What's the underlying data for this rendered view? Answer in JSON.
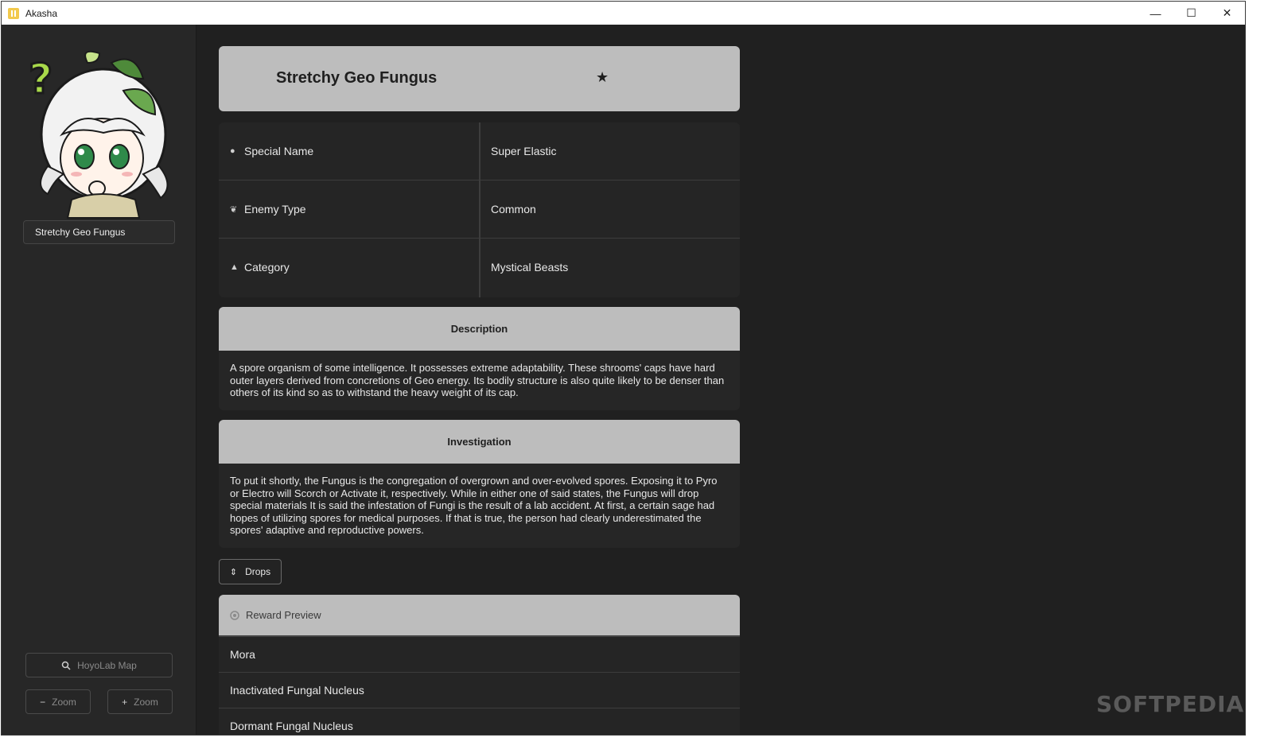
{
  "window": {
    "title": "Akasha",
    "controls": {
      "minimize": "—",
      "maximize": "☐",
      "close": "✕"
    }
  },
  "sidebar": {
    "search_value": "Stretchy Geo Fungus",
    "map_button": "HoyoLab Map",
    "zoom_out": "Zoom",
    "zoom_in": "Zoom",
    "zoom_out_symbol": "−",
    "zoom_in_symbol": "+"
  },
  "header": {
    "title": "Stretchy Geo Fungus",
    "favorite_icon": "★"
  },
  "info": [
    {
      "icon": "lightbulb-icon",
      "glyph": "●",
      "label": "Special Name",
      "value": "Super Elastic"
    },
    {
      "icon": "sprout-icon",
      "glyph": "❦",
      "label": "Enemy Type",
      "value": "Common"
    },
    {
      "icon": "shapes-icon",
      "glyph": "▲",
      "label": "Category",
      "value": "Mystical Beasts"
    }
  ],
  "description": {
    "title": "Description",
    "text": "A spore organism of some intelligence. It possesses extreme adaptability. These shrooms' caps have hard outer layers derived from concretions of Geo energy. Its bodily structure is also quite likely to be denser than others of its kind so as to withstand the heavy weight of its cap."
  },
  "investigation": {
    "title": "Investigation",
    "text": "To put it shortly, the Fungus is the congregation of overgrown and over-evolved spores. Exposing it to Pyro or Electro will Scorch or Activate it, respectively. While in either one of said states, the Fungus will drop special materials It is said the infestation of Fungi is the result of a lab accident. At first, a certain sage had hopes of utilizing spores for medical purposes. If that is true, the person had clearly underestimated the spores' adaptive and reproductive powers."
  },
  "drops": {
    "label": "Drops",
    "icon": "⇕"
  },
  "reward": {
    "title": "Reward Preview",
    "items": [
      "Mora",
      "Inactivated Fungal Nucleus",
      "Dormant Fungal Nucleus"
    ]
  },
  "watermark": "SOFTPEDIA"
}
